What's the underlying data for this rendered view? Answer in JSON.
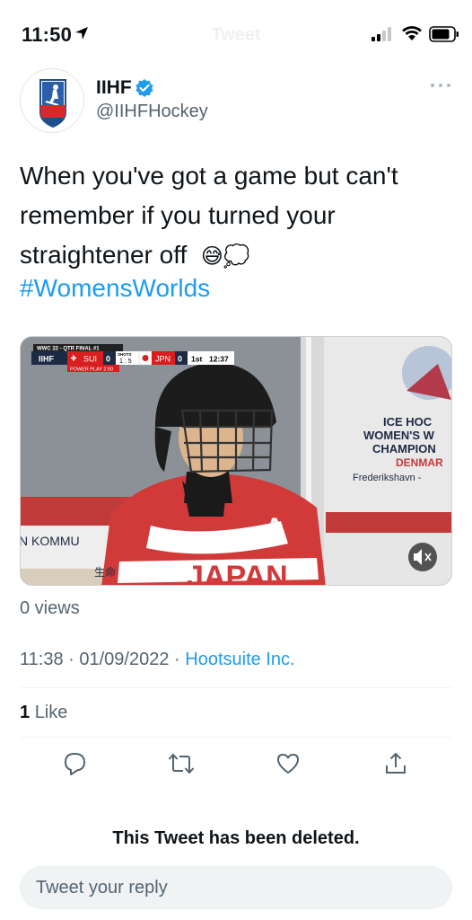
{
  "status_bar": {
    "time": "11:50"
  },
  "header": {
    "title": "Tweet"
  },
  "author": {
    "display_name": "IIHF",
    "handle": "@IIHFHockey",
    "avatar_text": "IIHF"
  },
  "tweet": {
    "text_line1": "When you've got a game but can't",
    "text_line2": "remember if you turned your",
    "text_line3": "straightener off",
    "emoji": "😅💭",
    "hashtag": "#WomensWorlds"
  },
  "media": {
    "scorebug": {
      "event": "WWC 22 - QTR FINAL #1",
      "brand": "IIHF",
      "team1": "SUI",
      "score1": "0",
      "shots_label": "SHOTS",
      "shots": "1 : 5",
      "team2": "JPN",
      "score2": "0",
      "period": "1st",
      "clock": "12:37",
      "power_play": "POWER PLAY 2:00"
    },
    "banner_line1": "ICE HOC",
    "banner_line2": "WOMEN'S W",
    "banner_line3": "CHAMPION",
    "banner_line4": "DENMAR",
    "banner_line5": "Frederikshavn -",
    "board_text": "N KOMMU",
    "jersey_text": "JAPAN",
    "jersey_letter": "A",
    "board_kanji": "生命"
  },
  "stats": {
    "views": "0 views",
    "likes_count": "1",
    "likes_label": "Like"
  },
  "meta": {
    "time": "11:38",
    "sep1": "·",
    "date": "01/09/2022",
    "sep2": "·",
    "source": "Hootsuite Inc."
  },
  "deleted_notice": "This Tweet has been deleted.",
  "reply": {
    "placeholder": "Tweet your reply"
  },
  "colors": {
    "accent": "#1d9bf0",
    "text": "#0f1419",
    "secondary": "#536471"
  }
}
